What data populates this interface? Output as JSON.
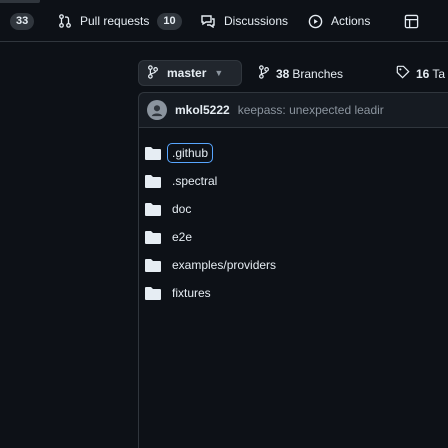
{
  "tabs": {
    "issues_count": "33",
    "pull_requests_label": "Pull requests",
    "pull_requests_count": "10",
    "discussions_label": "Discussions",
    "actions_label": "Actions"
  },
  "branch": {
    "current": "master",
    "branches_count": "38",
    "branches_label": "Branches",
    "tags_count": "16",
    "tags_label": "Ta"
  },
  "commit": {
    "author": "mkol5222",
    "message": "keepass: unexpected leadir"
  },
  "files": [
    {
      "name": ".github"
    },
    {
      "name": ".spectral"
    },
    {
      "name": "doc"
    },
    {
      "name": "e2e"
    },
    {
      "name": "examples/providers"
    },
    {
      "name": "fixtures"
    }
  ],
  "colors": {
    "background": "#0d1117",
    "text": "#e6edf3",
    "muted": "#8b949e",
    "border": "#30363d",
    "folder": "#e6edf3",
    "focus": "#58a6ff"
  }
}
